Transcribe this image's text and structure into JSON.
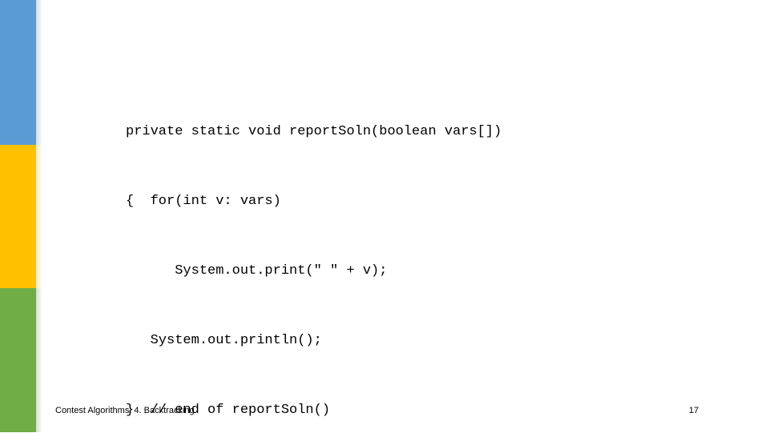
{
  "slide": {
    "background_color": "#ffffff",
    "sidebar": {
      "segments": [
        {
          "name": "blue",
          "color": "#5B9BD5"
        },
        {
          "name": "yellow",
          "color": "#FFC000"
        },
        {
          "name": "green",
          "color": "#70AD47"
        }
      ]
    },
    "code": {
      "language": "java",
      "lines": [
        "private static void reportSoln(boolean vars[])",
        "{  for(int v: vars)",
        "      System.out.print(\" \" + v);",
        "   System.out.println();",
        "}  // end of reportSoln()"
      ]
    },
    "footer": {
      "title": "Contest Algorithms: 4. Backtracking",
      "page_number": "17"
    }
  }
}
